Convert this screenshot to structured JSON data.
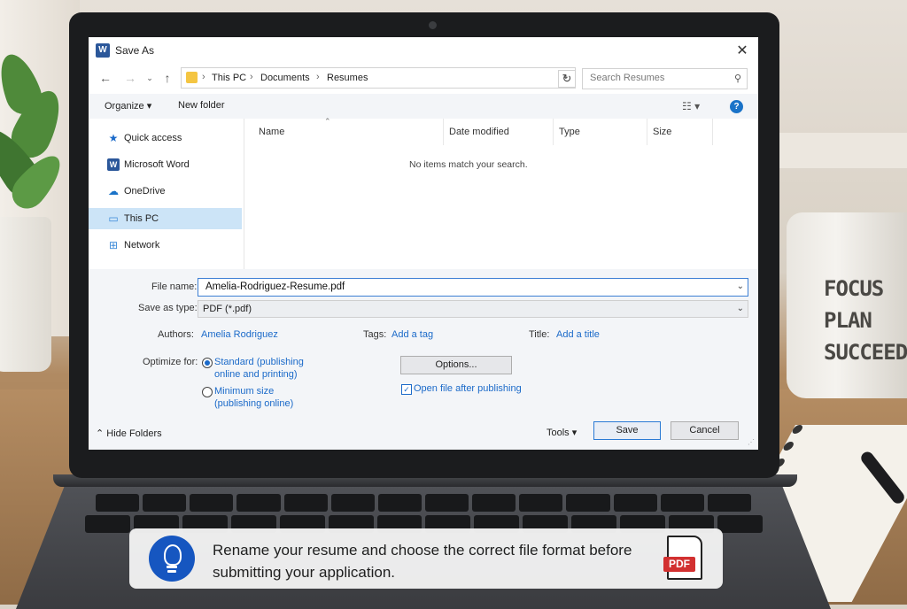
{
  "dialog": {
    "title": "Save As",
    "app_icon_letter": "W",
    "close_glyph": "✕"
  },
  "nav": {
    "breadcrumbs": [
      "This PC",
      "Documents",
      "Resumes"
    ],
    "search_placeholder": "Search Resumes"
  },
  "toolbar": {
    "organize_label": "Organize ▾",
    "new_folder_label": "New folder",
    "help_glyph": "?"
  },
  "sidebar": {
    "items": [
      {
        "label": "Quick access",
        "icon": "star-icon"
      },
      {
        "label": "Microsoft Word",
        "icon": "word-icon"
      },
      {
        "label": "OneDrive",
        "icon": "cloud-icon"
      },
      {
        "label": "This PC",
        "icon": "monitor-icon",
        "selected": true
      },
      {
        "label": "Network",
        "icon": "network-icon"
      }
    ]
  },
  "file_list": {
    "columns": [
      "Name",
      "Date modified",
      "Type",
      "Size"
    ],
    "empty_message": "No items match your search."
  },
  "form": {
    "file_name_label": "File name:",
    "file_name_value": "Amelia-Rodriguez-Resume.pdf",
    "save_type_label": "Save as type:",
    "save_type_value": "PDF (*.pdf)",
    "authors_label": "Authors:",
    "authors_value": "Amelia Rodriguez",
    "tags_label": "Tags:",
    "tags_value": "Add a tag",
    "title_label": "Title:",
    "title_value": "Add a title",
    "optimize_label": "Optimize for:",
    "optimize_options": [
      {
        "label": "Standard (publishing online and printing)",
        "selected": true
      },
      {
        "label": "Minimum size (publishing online)",
        "selected": false
      }
    ],
    "options_button": "Options...",
    "open_after_label": "Open file after publishing",
    "open_after_checked": true
  },
  "footer": {
    "hide_folders_label": "Hide Folders",
    "tools_label": "Tools",
    "save_label": "Save",
    "cancel_label": "Cancel"
  },
  "banner": {
    "text": "Rename your resume and choose the correct file format before submitting your application.",
    "pdf_label": "PDF"
  },
  "mug": {
    "lines": [
      "FOCUS",
      "PLAN",
      "SUCCEED"
    ]
  },
  "colors": {
    "accent": "#1b6ac9",
    "selection": "#cce4f7",
    "banner_icon": "#1656c0",
    "pdf_red": "#d23030"
  }
}
